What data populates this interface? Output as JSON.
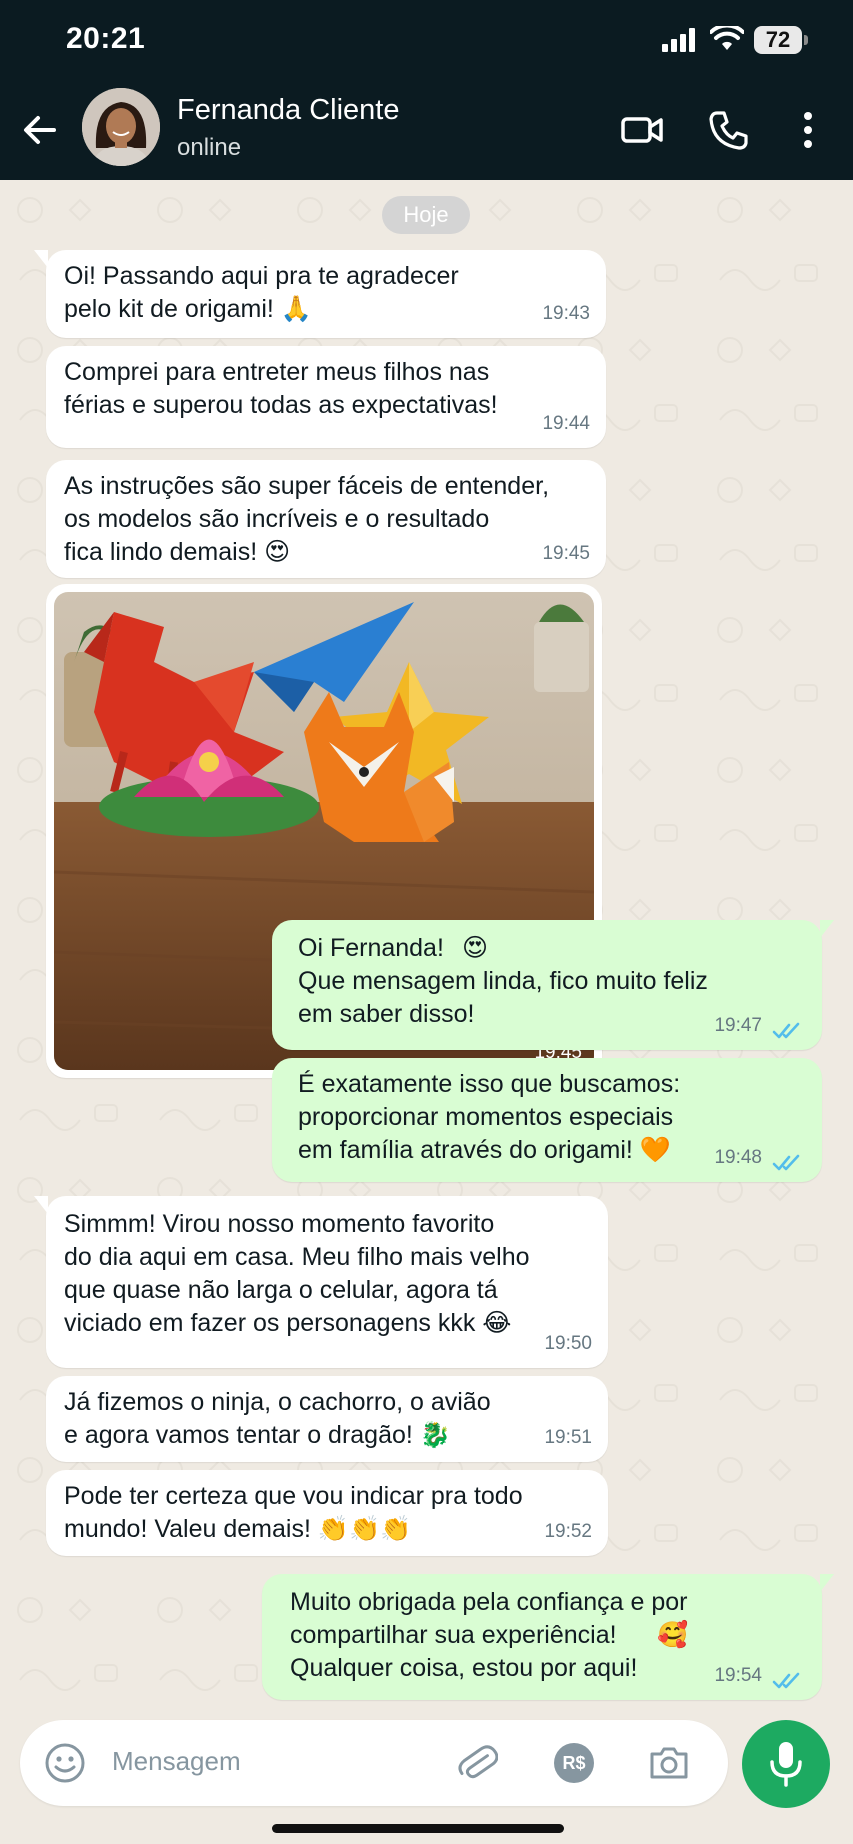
{
  "status_bar": {
    "time": "20:21",
    "battery": "72"
  },
  "header": {
    "contact_name": "Fernanda Cliente",
    "status": "online"
  },
  "date_divider": "Hoje",
  "messages": [
    {
      "dir": "in",
      "text": "Oi! Passando aqui pra te agradecer\npelo kit de origami!",
      "emoji": "🙏",
      "time": "19:43"
    },
    {
      "dir": "in",
      "text": "Comprei para entreter meus filhos nas\nférias e superou todas as expectativas!",
      "time": "19:44"
    },
    {
      "dir": "in",
      "text": "As instruções são super fáceis de entender,\nos modelos são incríveis e o resultado\nfica lindo demais!",
      "emoji": "😍",
      "time": "19:45"
    },
    {
      "dir": "in",
      "type": "image",
      "image_alt": "origami-photo",
      "time": "19:45"
    },
    {
      "dir": "out",
      "text": "Oi Fernanda!\nQue mensagem linda, fico muito feliz\nem saber disso!",
      "emoji": "😍",
      "time": "19:47"
    },
    {
      "dir": "out",
      "text": "É exatamente isso que buscamos:\nproporcionar momentos especiais\nem família através do origami!",
      "emoji": "🧡",
      "time": "19:48"
    },
    {
      "dir": "in",
      "text": "Simmm! Virou nosso momento favorito\ndo dia aqui em casa. Meu filho mais velho\nque quase não larga o celular, agora tá\nviciado em fazer os personagens kkk",
      "emoji": "😂",
      "time": "19:50"
    },
    {
      "dir": "in",
      "text": "Já fizemos o ninja, o cachorro, o avião\ne agora vamos tentar o dragão!",
      "emoji": "🐉",
      "time": "19:51"
    },
    {
      "dir": "in",
      "text": "Pode ter certeza que vou indicar pra todo\nmundo! Valeu demais!",
      "emoji": "👏👏👏",
      "time": "19:52"
    },
    {
      "dir": "out",
      "text": "Muito obrigada pela confiança e por\ncompartilhar sua experiência!\nQualquer coisa, estou por aqui!",
      "emoji": "🥰",
      "time": "19:54"
    }
  ],
  "composer": {
    "placeholder": "Mensagem",
    "currency_label": "R$"
  },
  "colors": {
    "header_bg": "#0b1b21",
    "chat_bg": "#efeae2",
    "incoming_bubble": "#ffffff",
    "outgoing_bubble": "#d9fdd3",
    "read_ticks": "#53bdeb",
    "mic_button": "#1daa61"
  }
}
